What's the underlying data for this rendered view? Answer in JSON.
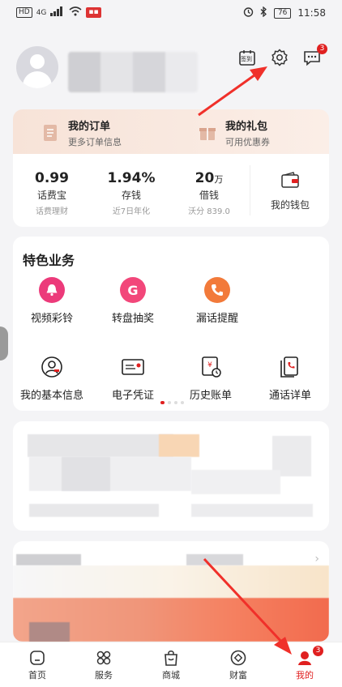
{
  "status_bar": {
    "left_chips": [
      "HD",
      "4G"
    ],
    "time": "11:58",
    "battery": "76"
  },
  "header": {
    "checkin_label": "签到",
    "message_badge": "3"
  },
  "quick_links": [
    {
      "title": "我的订单",
      "subtitle": "更多订单信息"
    },
    {
      "title": "我的礼包",
      "subtitle": "可用优惠券"
    }
  ],
  "finance": [
    {
      "value": "0.99",
      "unit": "",
      "name": "话费宝",
      "sub": "话费理财"
    },
    {
      "value": "1.94%",
      "unit": "",
      "name": "存钱",
      "sub": "近7日年化"
    },
    {
      "value": "20",
      "unit": "万",
      "name": "借钱",
      "sub": "沃分 839.0"
    }
  ],
  "wallet_label": "我的钱包",
  "features": {
    "title": "特色业务",
    "row1": [
      {
        "label": "视频彩铃",
        "icon": "video-ringtone-icon",
        "color": "#ec3a7a",
        "glyph": "SQ"
      },
      {
        "label": "转盘抽奖",
        "icon": "wheel-lottery-icon",
        "color": "#f2477a",
        "glyph": "G"
      },
      {
        "label": "漏话提醒",
        "icon": "missed-call-icon",
        "color": "#f27a3a",
        "glyph": "☎"
      }
    ],
    "row2": [
      {
        "label": "我的基本信息",
        "icon": "user-info-icon"
      },
      {
        "label": "电子凭证",
        "icon": "e-voucher-icon"
      },
      {
        "label": "历史账单",
        "icon": "bill-history-icon"
      },
      {
        "label": "通话详单",
        "icon": "call-detail-icon"
      }
    ]
  },
  "tabs": [
    {
      "label": "首页",
      "icon": "home-icon"
    },
    {
      "label": "服务",
      "icon": "service-icon"
    },
    {
      "label": "商城",
      "icon": "shop-icon"
    },
    {
      "label": "财富",
      "icon": "wealth-icon"
    },
    {
      "label": "我的",
      "icon": "profile-icon",
      "badge": "3",
      "active": true
    }
  ],
  "colors": {
    "accent": "#e02020",
    "peach": "#f7e3d8"
  }
}
